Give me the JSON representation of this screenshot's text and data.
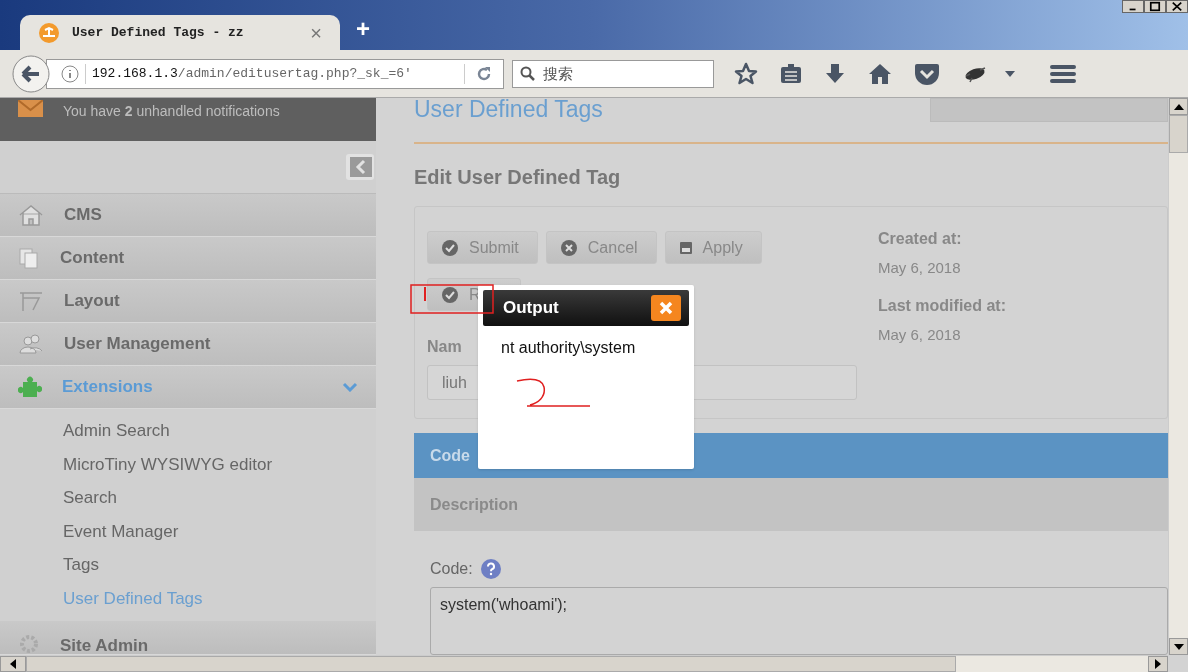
{
  "browser": {
    "tab_title": "User Defined Tags - zz",
    "tab_close": "×",
    "new_tab": "+",
    "url_host": "192.168.1.3",
    "url_path": "/admin/editusertag.php?_sk_=6'",
    "search_placeholder": "搜索"
  },
  "notification": {
    "text_before": "You have ",
    "count": "2",
    "text_after": " unhandled notifications"
  },
  "nav": [
    {
      "label": "CMS",
      "kind": "home",
      "selected": false
    },
    {
      "label": "Content",
      "kind": "pages",
      "selected": false
    },
    {
      "label": "Layout",
      "kind": "layout",
      "selected": false
    },
    {
      "label": "User Management",
      "kind": "users",
      "selected": false
    },
    {
      "label": "Extensions",
      "kind": "puzzle",
      "selected": true,
      "expanded": true,
      "children": [
        {
          "label": "Admin Search",
          "selected": false
        },
        {
          "label": "MicroTiny WYSIWYG editor",
          "selected": false
        },
        {
          "label": "Search",
          "selected": false
        },
        {
          "label": "Event Manager",
          "selected": false
        },
        {
          "label": "Tags",
          "selected": false
        },
        {
          "label": "User Defined Tags",
          "selected": true
        }
      ]
    },
    {
      "label": "Site Admin",
      "kind": "gear",
      "selected": false
    }
  ],
  "page": {
    "title": "User Defined Tags",
    "heading": "Edit User Defined Tag",
    "buttons": [
      {
        "label": "Submit",
        "kind": "check"
      },
      {
        "label": "Cancel",
        "kind": "cancel"
      },
      {
        "label": "Apply",
        "kind": "save"
      },
      {
        "label": "R",
        "kind": "check"
      }
    ],
    "meta": [
      {
        "label": "Created at:",
        "value": "May 6, 2018"
      },
      {
        "label": "Last modified at:",
        "value": "May 6, 2018"
      }
    ],
    "name_label": "Nam",
    "name_value": "liuh",
    "tabs": [
      {
        "label": "Code",
        "selected": true
      },
      {
        "label": "Description",
        "selected": false
      }
    ],
    "code_label": "Code:",
    "code_value": "system('whoami');"
  },
  "dialog": {
    "title": "Output",
    "output": "nt authority\\system"
  }
}
